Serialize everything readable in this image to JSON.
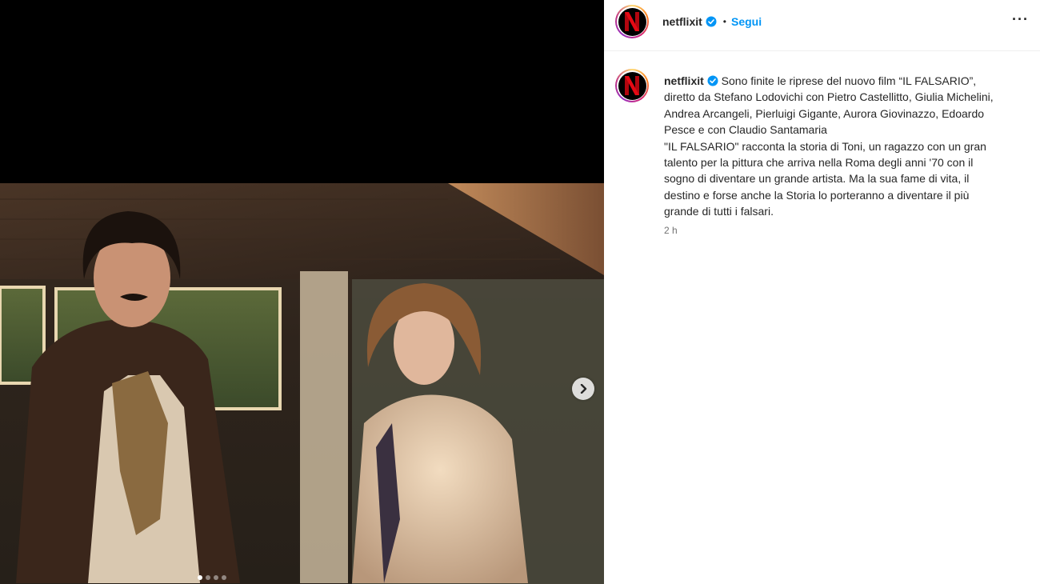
{
  "post": {
    "username": "netflixit",
    "separator": "•",
    "follow_label": "Segui",
    "more_label": "···",
    "caption_first": "Sono finite le riprese del nuovo film “IL FALSARIO”,",
    "caption_lines": [
      "diretto da Stefano Lodovichi con Pietro Castellitto, Giulia Michelini,",
      "Andrea Arcangeli, Pierluigi Gigante, Aurora Giovinazzo, Edoardo",
      "Pesce e con Claudio Santamaria",
      "\"IL FALSARIO\" racconta la storia di Toni, un ragazzo con un gran",
      "talento per la pittura che arriva nella Roma degli anni '70 con il",
      "sogno di diventare un grande artista. Ma la sua fame di vita, il",
      "destino e forse anche la Storia lo porteranno a diventare il più",
      "grande di tutti i falsari."
    ],
    "timestamp": "2 h",
    "carousel": {
      "total": 4,
      "active": 1
    }
  },
  "colors": {
    "accent": "#0095f6",
    "verified": "#0095f6",
    "netflix_red": "#e50914"
  },
  "icons": {
    "verified": "verified-badge-icon",
    "next": "chevron-right-icon",
    "more": "more-options-icon"
  }
}
